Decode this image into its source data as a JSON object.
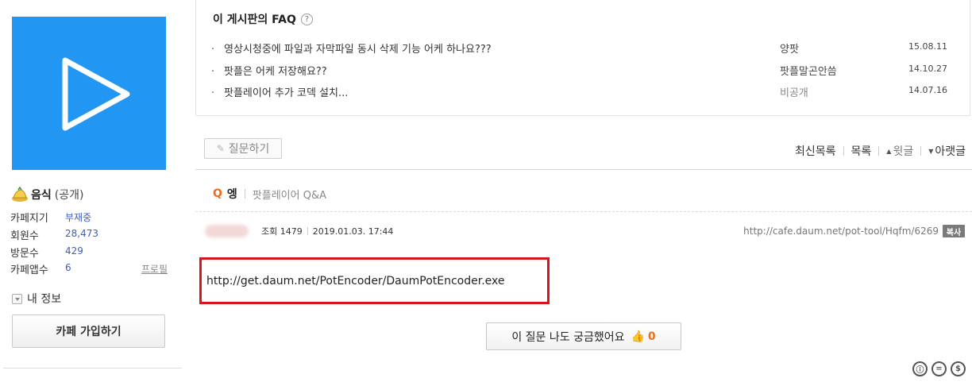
{
  "sidebar": {
    "cafe_name": "음식",
    "visibility": "(공개)",
    "stats": [
      {
        "label": "카페지기",
        "value": "부재중"
      },
      {
        "label": "회원수",
        "value": "28,473"
      },
      {
        "label": "방문수",
        "value": "429"
      },
      {
        "label": "카페앱수",
        "value": "6"
      }
    ],
    "profile_link": "프로필",
    "my_info": "내 정보",
    "join_button": "카페 가입하기"
  },
  "faq": {
    "title": "이 게시판의 FAQ",
    "help_glyph": "?",
    "items": [
      {
        "title": "영상시청중에 파일과 자막파일 동시 삭제 기능 어케 하나요???",
        "author": "양팟",
        "date": "15.08.11"
      },
      {
        "title": "팟플은 어케 저장해요??",
        "author": "팟플말곤안씀",
        "date": "14.10.27"
      },
      {
        "title": "팟플레이어 추가 코덱 설치...",
        "author": "비공개",
        "date": "14.07.16"
      }
    ]
  },
  "toolbar": {
    "ask_button": "질문하기",
    "links": {
      "latest": "최신목록",
      "list": "목록",
      "prev": "윗글",
      "next": "아랫글"
    }
  },
  "post": {
    "q_mark": "Q",
    "title": "엥",
    "board": "팟플레이어 Q&A",
    "views_label": "조회 1479",
    "datetime": "2019.01.03. 17:44",
    "url": "http://cafe.daum.net/pot-tool/Hqfm/6269",
    "copy_button": "복사",
    "body_link": "http://get.daum.net/PotEncoder/DaumPotEncoder.exe",
    "curious_button": "이 질문 나도 궁금했어요",
    "curious_count": "0"
  },
  "license_icons": [
    "ⓘ",
    "=",
    "$"
  ],
  "colors": {
    "logo_bg": "#2196f3",
    "highlight": "#d9141c",
    "q_accent": "#f06a1c",
    "link_blue": "#3b5dbd"
  }
}
